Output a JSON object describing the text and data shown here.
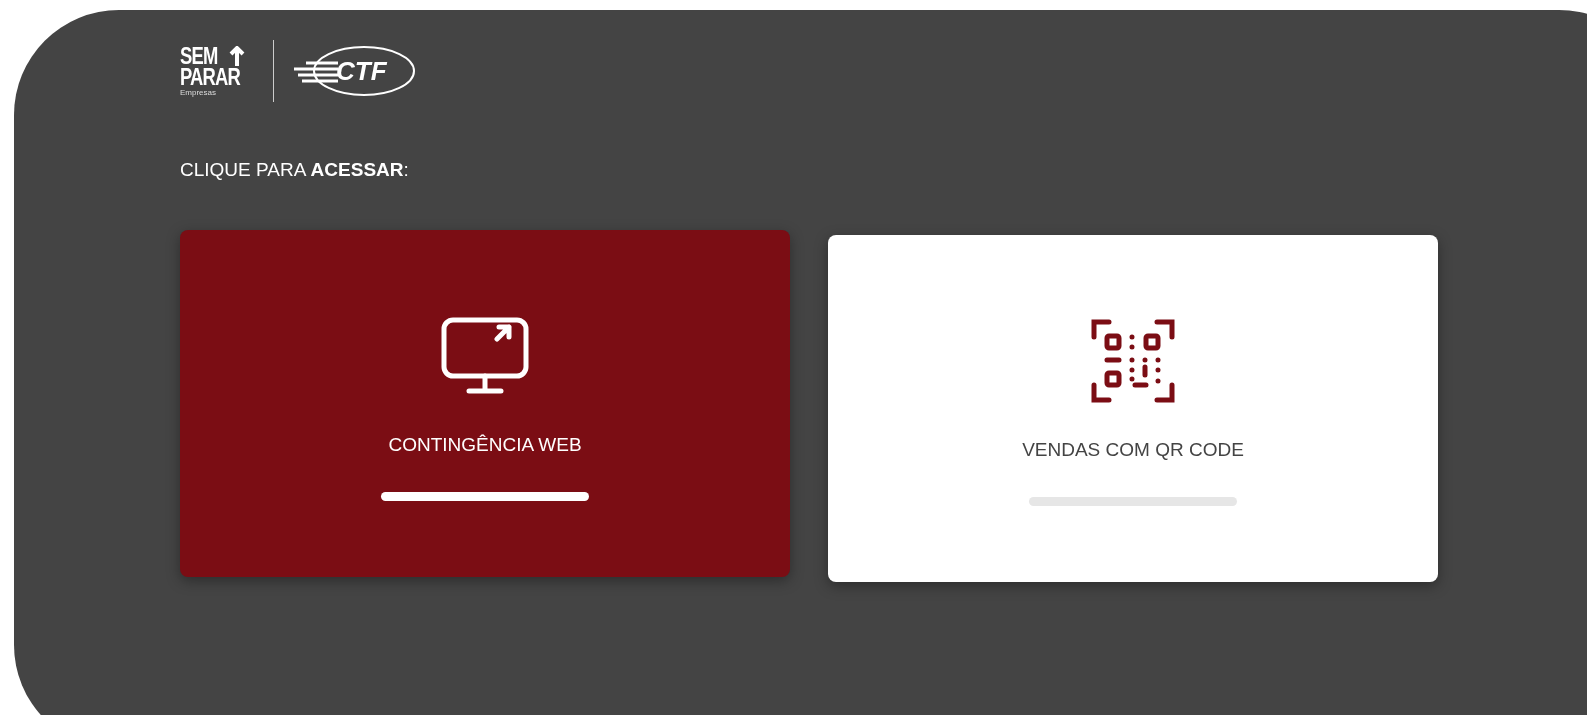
{
  "logo": {
    "brand_top": "SEM",
    "brand_bottom": "PARAR",
    "brand_sub": "Empresas",
    "partner": "CTF"
  },
  "heading": "CLIQUE PARA **ACESSAR**:",
  "cards": [
    {
      "kind": "monitor",
      "label": "CONTINGÊNCIA WEB",
      "selected": true
    },
    {
      "kind": "qr",
      "label": "VENDAS COM QR CODE",
      "selected": false
    }
  ]
}
